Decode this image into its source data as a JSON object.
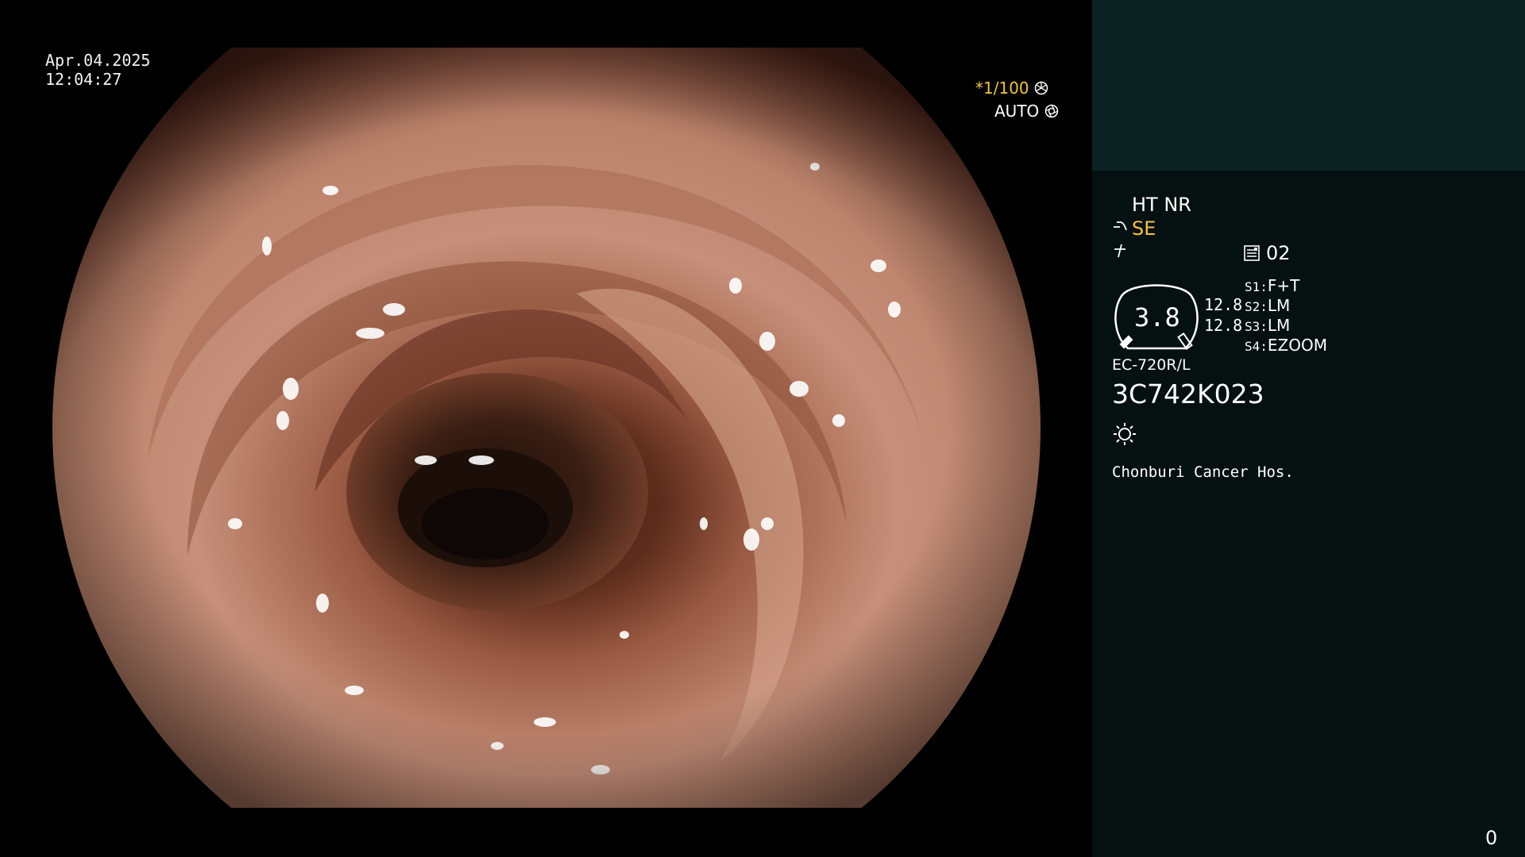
{
  "overlay": {
    "date": "Apr.04.2025",
    "time": "12:04:27",
    "shutter": {
      "asterisk": "*",
      "value": "1/100",
      "icon": "shutter-wheel-icon"
    },
    "iris": {
      "mode": "AUTO",
      "icon": "iris-icon"
    }
  },
  "panel": {
    "enhancement": "HT NR",
    "structure_mode": "SE",
    "structure_icon": "structure-enhancement-icon",
    "filter_icon": "color-filter-icon",
    "memory": {
      "icon": "memory-card-icon",
      "value": "02"
    },
    "zoom": {
      "value": "3.8",
      "readout_1": "12.8",
      "readout_2": "12.8"
    },
    "switches": [
      {
        "key": "S1:",
        "value": "F+T"
      },
      {
        "key": "S2:",
        "value": "LM"
      },
      {
        "key": "S3:",
        "value": "LM"
      },
      {
        "key": "S4:",
        "value": "EZOOM"
      }
    ],
    "scope_model": "EC-720R/L",
    "serial": "3C742K023",
    "light_icon": "light-source-icon",
    "hospital": "Chonburi Cancer Hos.",
    "counter": "0"
  },
  "colors": {
    "panel_top": "#0b2222",
    "panel_bottom": "#051010",
    "accent_yellow": "#f0c348",
    "text": "#ffffff"
  }
}
